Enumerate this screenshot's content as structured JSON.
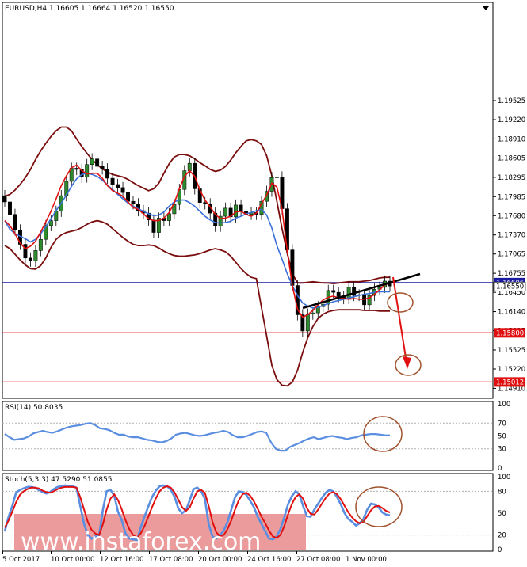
{
  "chart_data": {
    "type": "candlestick",
    "symbol_header": "EURUSD,H4  1.16605 1.16664 1.16520 1.16550",
    "price_axis": {
      "range": [
        1.1475,
        1.211
      ],
      "ticks": [
        "1.19525",
        "1.19220",
        "1.18910",
        "1.18605",
        "1.18295",
        "1.17985",
        "1.17680",
        "1.17370",
        "1.17065",
        "1.16755",
        "1.16450",
        "1.16140",
        "1.15835",
        "1.15525",
        "1.15220",
        "1.14910"
      ]
    },
    "time_labels": [
      "5 Oct 2017",
      "10 Oct 00:00",
      "12 Oct 16:00",
      "17 Oct 08:00",
      "20 Oct 00:00",
      "24 Oct 16:00",
      "27 Oct 08:00",
      "1 Nov 00:00"
    ],
    "horizontal_levels": [
      {
        "value": 1.16606,
        "label": "1.16606",
        "color": "#1a1aa0"
      },
      {
        "value": 1.158,
        "label": "1.15800",
        "color": "#e01010"
      },
      {
        "value": 1.15012,
        "label": "1.15012",
        "color": "#e01010"
      }
    ],
    "current_price": {
      "value": 1.1655,
      "label": "1.16550"
    },
    "close": [
      1.179,
      1.177,
      1.1745,
      1.1722,
      1.17,
      1.1695,
      1.1712,
      1.173,
      1.1752,
      1.176,
      1.1775,
      1.18,
      1.1823,
      1.1844,
      1.1842,
      1.183,
      1.185,
      1.1859,
      1.1847,
      1.1843,
      1.1828,
      1.1818,
      1.1813,
      1.1805,
      1.1791,
      1.1787,
      1.1776,
      1.1772,
      1.1761,
      1.1741,
      1.1764,
      1.176,
      1.1771,
      1.1786,
      1.181,
      1.184,
      1.1852,
      1.1811,
      1.1789,
      1.1787,
      1.1772,
      1.1751,
      1.1767,
      1.178,
      1.1766,
      1.1785,
      1.1775,
      1.177,
      1.1773,
      1.177,
      1.1791,
      1.1807,
      1.1829,
      1.183,
      1.1779,
      1.1713,
      1.1656,
      1.1609,
      1.1583,
      1.161,
      1.1612,
      1.1622,
      1.1626,
      1.1648,
      1.1645,
      1.1638,
      1.1635,
      1.1653,
      1.164,
      1.1641,
      1.1625,
      1.164,
      1.165,
      1.1653,
      1.1663,
      1.1655
    ],
    "ma_fast": [
      1.176,
      1.1752,
      1.1739,
      1.1724,
      1.1715,
      1.1719,
      1.1727,
      1.1742,
      1.1758,
      1.1775,
      1.1795,
      1.1816,
      1.1832,
      1.1845,
      1.1849,
      1.184,
      1.1835,
      1.1836,
      1.1836,
      1.1828,
      1.1816,
      1.1808,
      1.1804,
      1.1799,
      1.179,
      1.1781,
      1.1778,
      1.1771,
      1.1763,
      1.176,
      1.176,
      1.1764,
      1.1773,
      1.1788,
      1.1811,
      1.1831,
      1.184,
      1.1831,
      1.1809,
      1.1793,
      1.1782,
      1.177,
      1.1763,
      1.1764,
      1.1767,
      1.1774,
      1.1775,
      1.177,
      1.1767,
      1.1772,
      1.1787,
      1.1801,
      1.182,
      1.1814,
      1.1778,
      1.1712,
      1.1656,
      1.1618,
      1.1605,
      1.1609,
      1.1616,
      1.1625,
      1.1633,
      1.1637,
      1.1639,
      1.1636,
      1.1635,
      1.1634,
      1.1635,
      1.1634,
      1.1634,
      1.1636,
      1.1642,
      1.1649,
      1.1657,
      1.166
    ],
    "ma_slow": [
      1.176,
      1.1746,
      1.1739,
      1.1735,
      1.1731,
      1.1726,
      1.173,
      1.1739,
      1.175,
      1.1763,
      1.1776,
      1.1788,
      1.1801,
      1.1815,
      1.1827,
      1.1834,
      1.1836,
      1.1834,
      1.1831,
      1.1825,
      1.1817,
      1.181,
      1.1802,
      1.1795,
      1.1788,
      1.1783,
      1.1779,
      1.1775,
      1.1771,
      1.1768,
      1.1769,
      1.1774,
      1.1783,
      1.179,
      1.1793,
      1.1793,
      1.1789,
      1.1783,
      1.1775,
      1.1767,
      1.1761,
      1.1757,
      1.1756,
      1.1757,
      1.1759,
      1.1764,
      1.1767,
      1.1771,
      1.1773,
      1.1776,
      1.1778,
      1.1769,
      1.1748,
      1.172,
      1.1698,
      1.1675,
      1.1656,
      1.164,
      1.1628,
      1.1623,
      1.162,
      1.1621,
      1.1624,
      1.1627,
      1.163,
      1.1632,
      1.1634,
      1.1636,
      1.1638,
      1.164,
      1.1642,
      1.1643,
      1.1645,
      1.1646,
      1.1646,
      1.1646
    ],
    "bb_upper": [
      1.1799,
      1.1802,
      1.1809,
      1.1818,
      1.1829,
      1.1842,
      1.1858,
      1.1872,
      1.1884,
      1.1895,
      1.1904,
      1.191,
      1.191,
      1.1904,
      1.1891,
      1.1879,
      1.1868,
      1.1858,
      1.185,
      1.1843,
      1.1838,
      1.1834,
      1.1832,
      1.183,
      1.1826,
      1.1821,
      1.1816,
      1.1812,
      1.1808,
      1.1811,
      1.182,
      1.1836,
      1.1851,
      1.1862,
      1.1866,
      1.1866,
      1.1864,
      1.1859,
      1.1853,
      1.1848,
      1.1842,
      1.1839,
      1.1841,
      1.1847,
      1.1857,
      1.1869,
      1.1879,
      1.1888,
      1.189,
      1.1888,
      1.1882,
      1.1864,
      1.1832,
      1.1791,
      1.1747,
      1.1708,
      1.1675,
      1.166,
      1.166,
      1.1661,
      1.1662,
      1.1661,
      1.166,
      1.166,
      1.1659,
      1.166,
      1.1661,
      1.1662,
      1.1662,
      1.1662,
      1.1663,
      1.1664,
      1.1666,
      1.1668,
      1.1669,
      1.1669
    ],
    "bb_lower": [
      1.172,
      1.1715,
      1.1706,
      1.1697,
      1.1689,
      1.1683,
      1.1682,
      1.1688,
      1.17,
      1.1717,
      1.173,
      1.1737,
      1.1741,
      1.1743,
      1.1745,
      1.1749,
      1.1754,
      1.1758,
      1.176,
      1.1758,
      1.1754,
      1.1747,
      1.174,
      1.1733,
      1.1727,
      1.1722,
      1.172,
      1.172,
      1.1721,
      1.172,
      1.1716,
      1.1711,
      1.1707,
      1.1704,
      1.1703,
      1.1703,
      1.1704,
      1.1705,
      1.1707,
      1.171,
      1.1713,
      1.1715,
      1.1713,
      1.171,
      1.1703,
      1.1693,
      1.1683,
      1.1675,
      1.1669,
      1.1667,
      1.162,
      1.1575,
      1.1528,
      1.1505,
      1.1496,
      1.1495,
      1.1501,
      1.152,
      1.1548,
      1.1572,
      1.159,
      1.1603,
      1.161,
      1.1614,
      1.1616,
      1.1617,
      1.1617,
      1.1617,
      1.1617,
      1.1617,
      1.1616,
      1.1616,
      1.1616,
      1.1615,
      1.1615,
      1.1615
    ],
    "rsi": {
      "label": "RSI(14) 50.8035",
      "ticks": [
        "100",
        "70",
        "50",
        "30",
        "0"
      ],
      "values": [
        53,
        48,
        44,
        45,
        46,
        49,
        54,
        56,
        58,
        56,
        55,
        57,
        60,
        63,
        65,
        66,
        67,
        69,
        70,
        67,
        62,
        61,
        59,
        55,
        52,
        52,
        49,
        48,
        48,
        46,
        44,
        43,
        41,
        40,
        42,
        46,
        52,
        54,
        55,
        53,
        51,
        50,
        51,
        53,
        55,
        56,
        58,
        56,
        51,
        48,
        48,
        50,
        53,
        56,
        57,
        55,
        40,
        30,
        27,
        27,
        33,
        36,
        39,
        43,
        46,
        48,
        45,
        47,
        49,
        50,
        48,
        47,
        45,
        47,
        48,
        51,
        52,
        53,
        53,
        52,
        51,
        51
      ]
    },
    "stoch": {
      "label": "Stoch(5,3,3) 47.5290 51.0855",
      "ticks": [
        "100",
        "80",
        "50",
        "20",
        "0"
      ],
      "main": [
        25,
        45,
        60,
        78,
        82,
        84,
        86,
        86,
        85,
        82,
        79,
        77,
        79,
        83,
        86,
        87,
        88,
        87,
        87,
        85,
        60,
        35,
        20,
        15,
        18,
        20,
        55,
        80,
        82,
        74,
        52,
        40,
        22,
        15,
        14,
        13,
        30,
        45,
        59,
        72,
        81,
        87,
        88,
        87,
        82,
        72,
        56,
        50,
        54,
        68,
        83,
        85,
        80,
        70,
        35,
        18,
        15,
        20,
        26,
        38,
        55,
        72,
        80,
        79,
        75,
        67,
        58,
        45,
        35,
        25,
        15,
        14,
        18,
        28,
        44,
        62,
        73,
        80,
        76,
        60,
        46,
        45,
        55,
        63,
        71,
        78,
        82,
        80,
        72,
        62,
        50,
        42,
        38,
        33,
        36,
        42,
        55,
        63,
        62,
        58,
        51,
        48,
        47
      ],
      "signal": [
        30,
        40,
        52,
        65,
        75,
        80,
        83,
        85,
        85,
        84,
        81,
        79,
        78,
        80,
        83,
        85,
        86,
        86,
        86,
        85,
        72,
        55,
        38,
        27,
        22,
        20,
        35,
        55,
        70,
        76,
        68,
        55,
        40,
        28,
        20,
        16,
        22,
        32,
        45,
        58,
        70,
        80,
        85,
        87,
        85,
        78,
        68,
        58,
        53,
        58,
        70,
        80,
        82,
        78,
        60,
        38,
        24,
        18,
        20,
        28,
        40,
        55,
        68,
        76,
        78,
        74,
        66,
        56,
        45,
        36,
        26,
        18,
        16,
        20,
        32,
        48,
        62,
        72,
        76,
        70,
        57,
        49,
        48,
        55,
        63,
        71,
        77,
        79,
        76,
        69,
        60,
        51,
        44,
        39,
        36,
        38,
        46,
        54,
        59,
        60,
        57,
        53,
        51
      ]
    },
    "watermark": "www.instaforex.com"
  }
}
